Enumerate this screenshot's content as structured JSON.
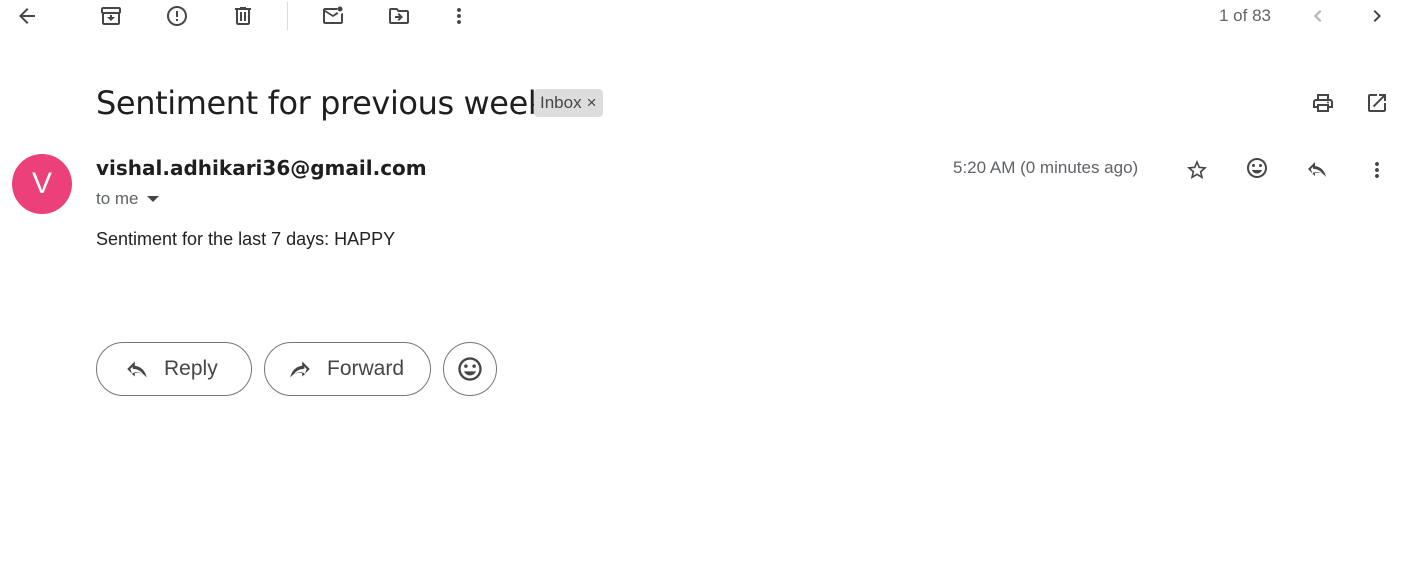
{
  "toolbar": {
    "back_icon": "arrow-back-icon",
    "archive_icon": "archive-icon",
    "report_spam_icon": "report-spam-icon",
    "delete_icon": "trash-icon",
    "mark_unread_icon": "mark-unread-icon",
    "move_to_icon": "move-to-folder-icon",
    "more_icon": "more-vertical-icon"
  },
  "pager": {
    "text": "1 of 83",
    "newer_icon": "chevron-left-icon",
    "older_icon": "chevron-right-icon"
  },
  "message": {
    "subject": "Sentiment for previous week",
    "label": "Inbox",
    "label_remove": "×",
    "print_icon": "print-icon",
    "open_new_window_icon": "open-in-new-icon",
    "avatar_letter": "V",
    "avatar_color": "#ec407a",
    "sender": "vishal.adhikari36@gmail.com",
    "recipient": "to me",
    "timestamp": "5:20 AM (0 minutes ago)",
    "star_icon": "star-outline-icon",
    "emoji_icon": "emoji-reaction-icon",
    "reply_icon": "reply-icon",
    "more_icon": "more-vertical-icon",
    "body": "Sentiment for the last 7 days: HAPPY"
  },
  "actions": {
    "reply_label": "Reply",
    "forward_label": "Forward"
  }
}
